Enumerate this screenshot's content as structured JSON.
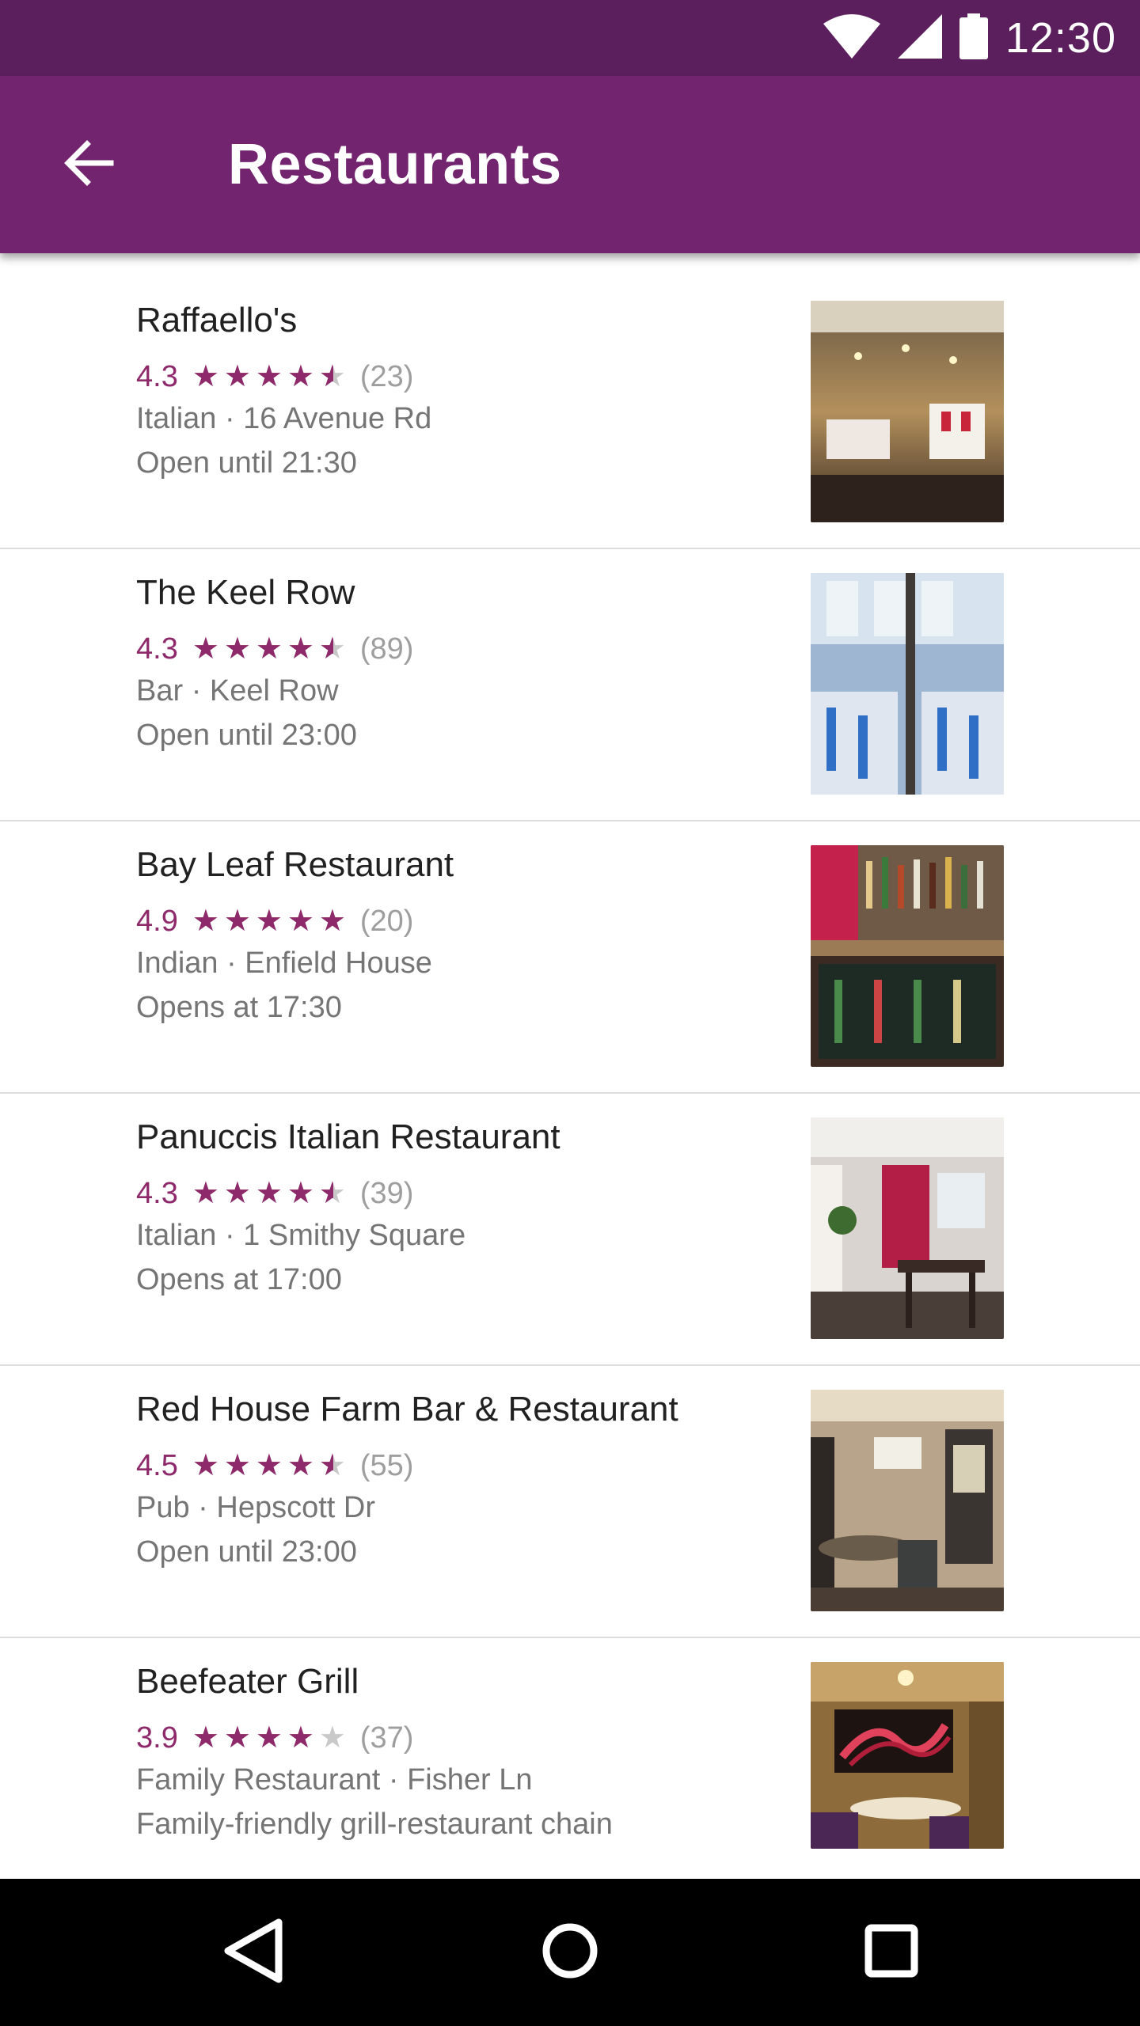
{
  "status_bar": {
    "time": "12:30",
    "icons": [
      "wifi-icon",
      "cell-signal-icon",
      "battery-icon"
    ]
  },
  "app_bar": {
    "title": "Restaurants",
    "back_icon": "arrow-left-icon",
    "color": "#73246f",
    "status_color": "#5c1f5e"
  },
  "accent_color": "#8e2a6b",
  "restaurants": [
    {
      "name": "Raffaello's",
      "rating": "4.3",
      "rating_value": 4.3,
      "reviews": "(23)",
      "meta": "Italian · 16 Avenue Rd",
      "status": "Open until 21:30"
    },
    {
      "name": "The Keel Row",
      "rating": "4.3",
      "rating_value": 4.3,
      "reviews": "(89)",
      "meta": "Bar · Keel Row",
      "status": "Open until 23:00"
    },
    {
      "name": "Bay Leaf Restaurant",
      "rating": "4.9",
      "rating_value": 4.9,
      "reviews": "(20)",
      "meta": "Indian · Enfield House",
      "status": "Opens at 17:30"
    },
    {
      "name": "Panuccis Italian Restaurant",
      "rating": "4.3",
      "rating_value": 4.3,
      "reviews": "(39)",
      "meta": "Italian · 1 Smithy Square",
      "status": "Opens at 17:00"
    },
    {
      "name": "Red House Farm Bar & Restaurant",
      "rating": "4.5",
      "rating_value": 4.5,
      "reviews": "(55)",
      "meta": "Pub · Hepscott Dr",
      "status": "Open until 23:00"
    },
    {
      "name": "Beefeater Grill",
      "rating": "3.9",
      "rating_value": 3.9,
      "reviews": "(37)",
      "meta": "Family Restaurant · Fisher Ln",
      "status": "Family-friendly grill-restaurant chain"
    }
  ],
  "nav_bar": {
    "back_icon": "triangle-back-icon",
    "home_icon": "circle-home-icon",
    "recents_icon": "square-recents-icon"
  }
}
